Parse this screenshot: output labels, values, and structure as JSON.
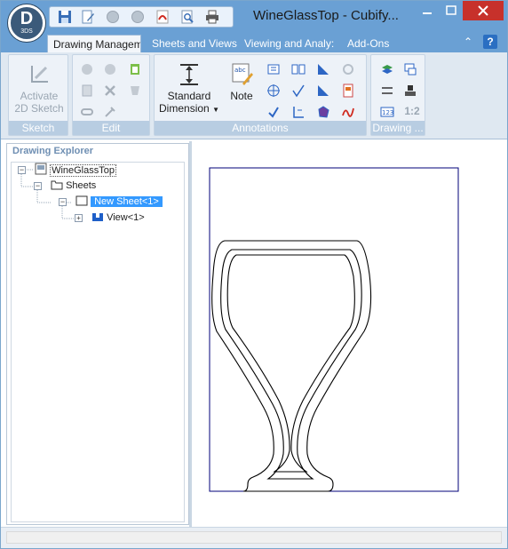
{
  "window": {
    "title": "WineGlassTop - Cubify...",
    "logo_letter": "D",
    "logo_sub": "3DS"
  },
  "quick_access": [
    "save-icon",
    "edit-icon",
    "undo-icon",
    "redo-icon",
    "pdf-icon",
    "print-preview-icon",
    "print-icon"
  ],
  "tabs": [
    {
      "label": "Drawing Managem",
      "active": true
    },
    {
      "label": "Sheets and Views",
      "active": false
    },
    {
      "label": "Viewing and Analy:",
      "active": false
    },
    {
      "label": "Add-Ons",
      "active": false
    }
  ],
  "ribbon": {
    "sketch": {
      "label": "Sketch",
      "activate_line1": "Activate",
      "activate_line2": "2D Sketch"
    },
    "edit": {
      "label": "Edit"
    },
    "annotations": {
      "label": "Annotations",
      "standard_line1": "Standard",
      "standard_line2": "Dimension",
      "note": "Note",
      "note_icon_text": "abc"
    },
    "drawing": {
      "label": "Drawing ...",
      "scale": "1:2",
      "scale_icon_text": "123"
    }
  },
  "explorer": {
    "title": "Drawing Explorer",
    "root": "WineGlassTop",
    "sheets": "Sheets",
    "sheet": "New Sheet<1>",
    "view": "View<1>"
  },
  "colors": {
    "titlebar": "#6aa0d4",
    "close": "#c7312b",
    "selection": "#3399ff",
    "sheet_border": "#00007a"
  }
}
